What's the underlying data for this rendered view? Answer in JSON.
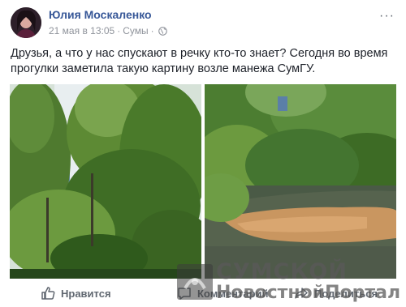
{
  "post": {
    "author": "Юлия Москаленко",
    "date": "21 мая в 13:05",
    "separator": "·",
    "location": "Сумы",
    "more_label": "···",
    "text": "Друзья, а что у нас спускают в речку кто-то знает? Сегодня во время прогулки заметила такую картину возле манежа СумГУ."
  },
  "photos": [
    {
      "subject": "trees-riverbank"
    },
    {
      "subject": "river-with-orange-discharge"
    }
  ],
  "actions": {
    "like": "Нравится",
    "comment": "Комментарий",
    "share": "Поделиться"
  },
  "watermark": {
    "line1": "СУМСКОЙ",
    "line2": "НовостнойПортал"
  },
  "colors": {
    "link": "#385898",
    "meta": "#90949c",
    "action": "#606770"
  }
}
